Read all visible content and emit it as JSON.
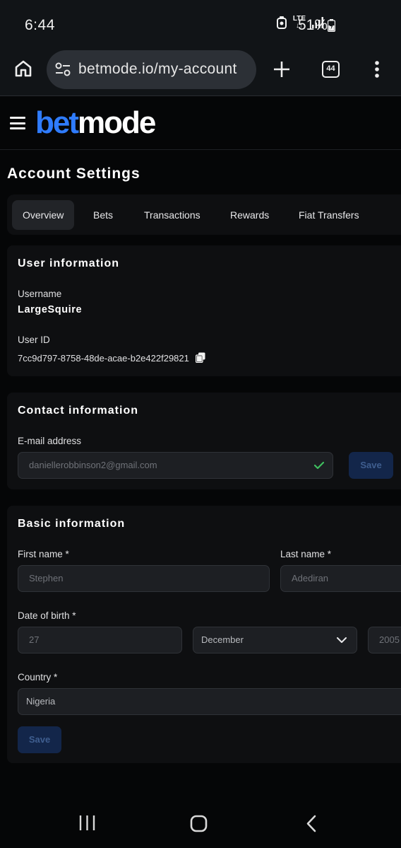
{
  "status_bar": {
    "time": "6:44",
    "network": "LTE",
    "battery": "51%"
  },
  "browser": {
    "url": "betmode.io/my-account",
    "tab_count": "44"
  },
  "site": {
    "logo_part1": "bet",
    "logo_part2": "mode",
    "brand_color": "#2f7cff"
  },
  "page": {
    "title": "Account Settings"
  },
  "tabs": [
    {
      "label": "Overview",
      "active": true
    },
    {
      "label": "Bets",
      "active": false
    },
    {
      "label": "Transactions",
      "active": false
    },
    {
      "label": "Rewards",
      "active": false
    },
    {
      "label": "Fiat Transfers",
      "active": false
    }
  ],
  "user_info": {
    "title": "User information",
    "username_label": "Username",
    "username": "LargeSquire",
    "userid_label": "User ID",
    "userid": "7cc9d797-8758-48de-acae-b2e422f29821"
  },
  "contact_info": {
    "title": "Contact information",
    "email_label": "E-mail address",
    "email": "daniellerobbinson2@gmail.com",
    "save_label": "Save"
  },
  "basic_info": {
    "title": "Basic information",
    "first_name_label": "First name *",
    "first_name": "Stephen",
    "last_name_label": "Last name *",
    "last_name": "Adediran",
    "dob_label": "Date of birth *",
    "dob_day": "27",
    "dob_month": "December",
    "dob_year": "2005",
    "country_label": "Country *",
    "country": "Nigeria",
    "save_label": "Save"
  }
}
